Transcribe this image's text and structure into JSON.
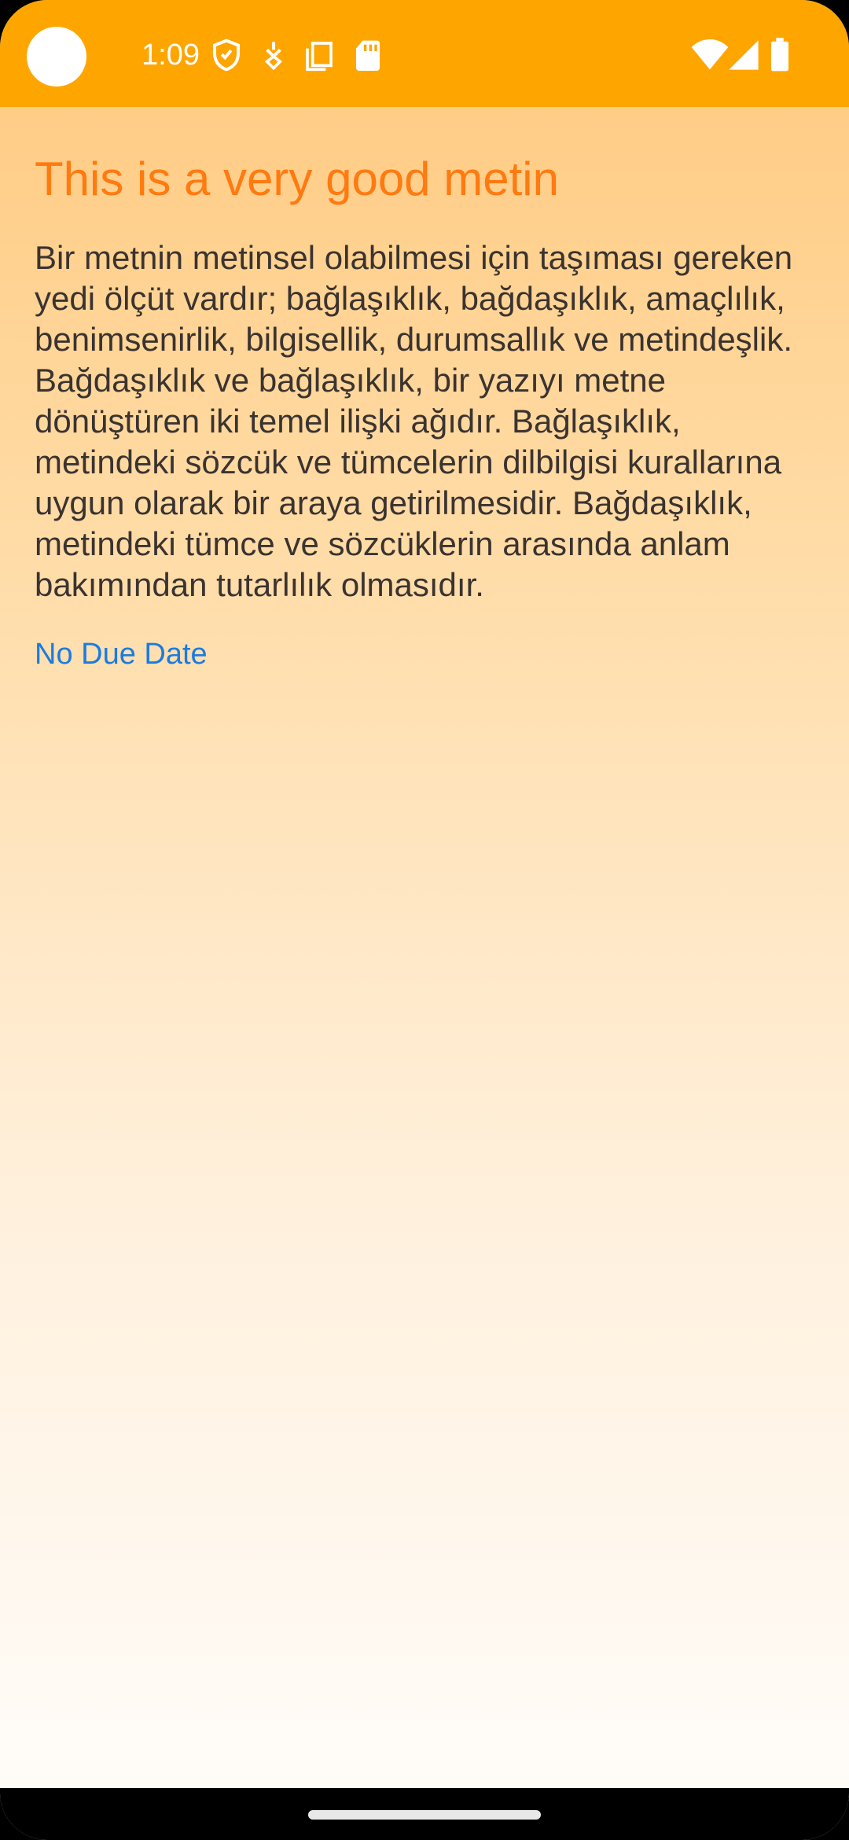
{
  "status_bar": {
    "time": "1:09",
    "left_icons": [
      "shield-icon",
      "location-pin-icon",
      "copy-icon",
      "sd-card-icon"
    ],
    "right_icons": [
      "wifi-icon",
      "cell-signal-icon",
      "battery-icon"
    ],
    "color": "#ffa500"
  },
  "note": {
    "title": "This is a very good metin",
    "body": "Bir metnin metinsel olabilmesi için taşıması gereken yedi ölçüt vardır; bağlaşıklık, bağdaşıklık, amaçlılık, benimsenirlik, bilgisellik, durumsallık ve metindeşlik. Bağdaşıklık ve bağlaşıklık, bir yazıyı metne dönüştüren iki temel ilişki ağıdır. Bağlaşıklık, metindeki sözcük ve tümcelerin dilbilgisi kurallarına uygun olarak bir araya getirilmesidir. Bağdaşıklık, metindeki tümce ve sözcüklerin arasında anlam bakımından tutarlılık olmasıdır.",
    "due_date": "No Due Date"
  },
  "colors": {
    "title": "#ff7a10",
    "link": "#1a7ce0",
    "body_text": "#3a3330",
    "background_top": "#ffc97e",
    "background_bottom": "#fffdfb"
  }
}
